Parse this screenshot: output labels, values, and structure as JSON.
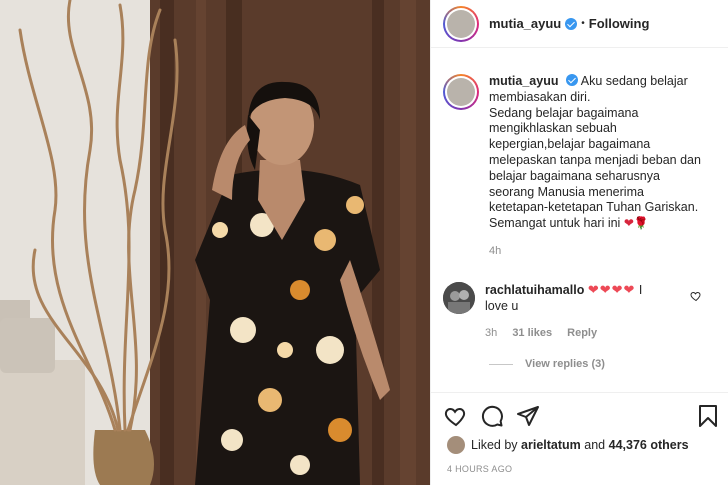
{
  "post": {
    "username": "mutia_ayuu",
    "follow_dot": "•",
    "follow_status": "Following"
  },
  "caption": {
    "username": "mutia_ayuu",
    "lines": [
      "Aku sedang belajar",
      "membiasakan diri.",
      "Sedang belajar bagaimana",
      "mengikhlaskan sebuah",
      "kepergian,belajar bagaimana",
      "melepaskan tanpa menjadi beban dan",
      "belajar bagaimana seharusnya",
      "seorang Manusia menerima",
      "ketetapan-ketetapan Tuhan Gariskan.",
      "Semangat untuk hari ini"
    ],
    "emojis": "❤🌹",
    "time": "4h"
  },
  "comment": {
    "username": "rachlatuihamallo",
    "hearts": "❤❤❤❤",
    "text_a": " I",
    "text_b": "love u",
    "time": "3h",
    "likes": "31 likes",
    "reply": "Reply",
    "view_replies": "View replies (3)"
  },
  "likes_line": {
    "prefix": "Liked by ",
    "user": "arieltatum",
    "mid": " and ",
    "others": "44,376 others"
  },
  "timestamp": "4 HOURS AGO",
  "icons": {
    "like": "heart-icon",
    "comment": "comment-icon",
    "share": "share-icon",
    "save": "bookmark-icon"
  },
  "colors": {
    "accent": "#3897f0",
    "heart": "#ed4956",
    "muted": "#8e8e8e"
  }
}
